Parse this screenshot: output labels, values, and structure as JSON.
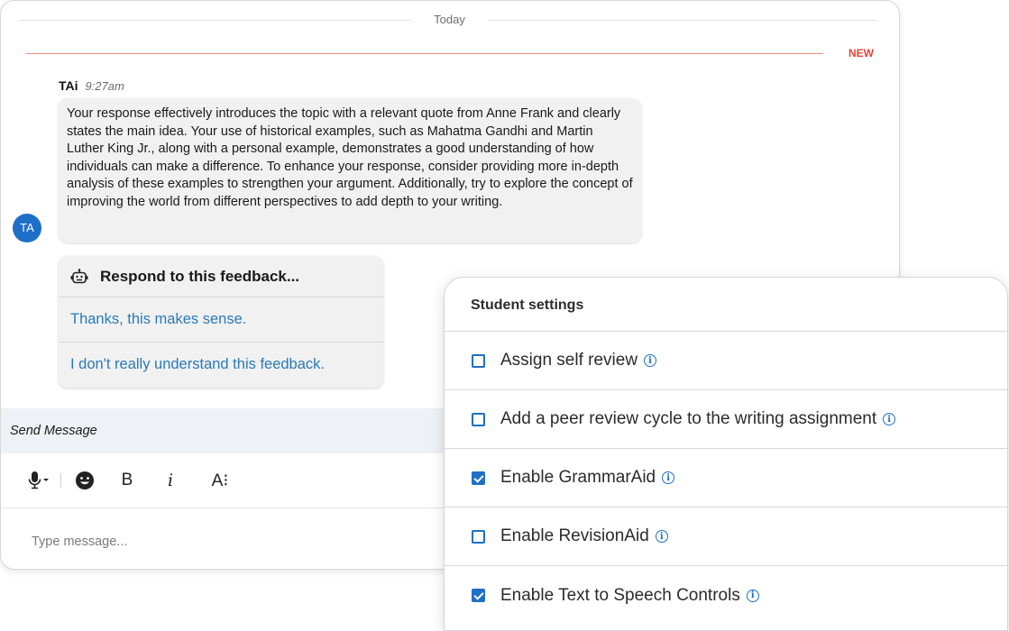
{
  "chat": {
    "date_divider": "Today",
    "new_divider": "NEW",
    "message": {
      "sender": "TAi",
      "time": "9:27am",
      "avatar_initials": "TA",
      "body": "Your response effectively introduces the topic with a relevant quote from Anne Frank and clearly states the main idea. Your use of historical examples, such as Mahatma Gandhi and Martin Luther King Jr., along with a personal example, demonstrates a good understanding of how individuals can make a difference. To enhance your response, consider providing more in-depth analysis of these examples to strengthen your argument. Additionally, try to explore the concept of improving the world from different perspectives to add depth to your writing."
    },
    "respond": {
      "title": "Respond to this feedback...",
      "icon": "robot-icon",
      "options": [
        "Thanks, this makes sense.",
        "I don't really understand this feedback."
      ]
    },
    "send_label": "Send Message",
    "toolbar": {
      "mic_icon": "microphone-icon",
      "emoji_icon": "emoji-icon",
      "bold": "B",
      "italic": "i",
      "font_size": "A⁝"
    },
    "input_placeholder": "Type message..."
  },
  "settings": {
    "title": "Student settings",
    "items": [
      {
        "label": "Assign self review",
        "checked": false
      },
      {
        "label": "Add a peer review cycle to the writing assignment",
        "checked": false
      },
      {
        "label": "Enable GrammarAid",
        "checked": true
      },
      {
        "label": "Enable RevisionAid",
        "checked": false
      },
      {
        "label": "Enable Text to Speech Controls",
        "checked": true
      }
    ]
  },
  "colors": {
    "accent": "#1f6fc7",
    "new_divider": "#ea4335",
    "link": "#2a7ab8",
    "bubble": "#f1f1f1"
  }
}
